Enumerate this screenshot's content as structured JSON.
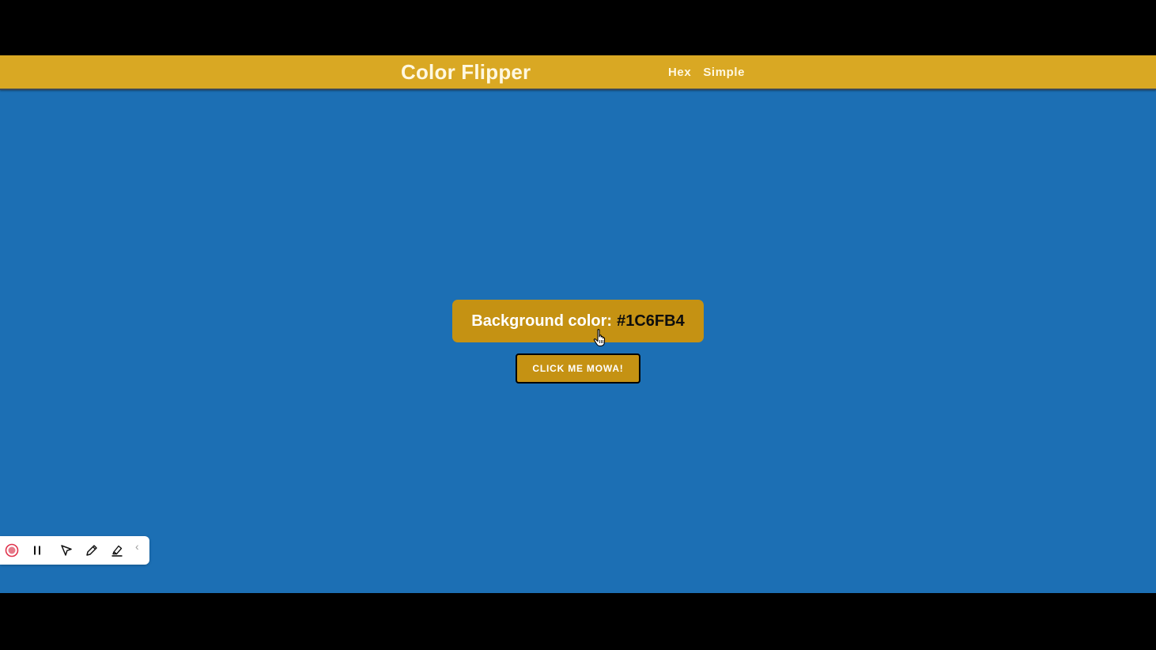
{
  "navbar": {
    "title": "Color Flipper",
    "links": [
      "Hex",
      "Simple"
    ]
  },
  "main": {
    "color_label": "Background color:",
    "color_value": "#1C6FB4",
    "button_label": "CLICK ME MOWA!"
  },
  "toolbar": {
    "icons": [
      "record-icon",
      "pause-icon",
      "pointer-icon",
      "pen-icon",
      "highlighter-icon",
      "chevron-left-icon"
    ],
    "collapse_glyph": "‹"
  },
  "colors": {
    "background": "#1C6FB4",
    "accent": "#D9A823",
    "box": "#C59213",
    "letterbox": "#000000"
  }
}
